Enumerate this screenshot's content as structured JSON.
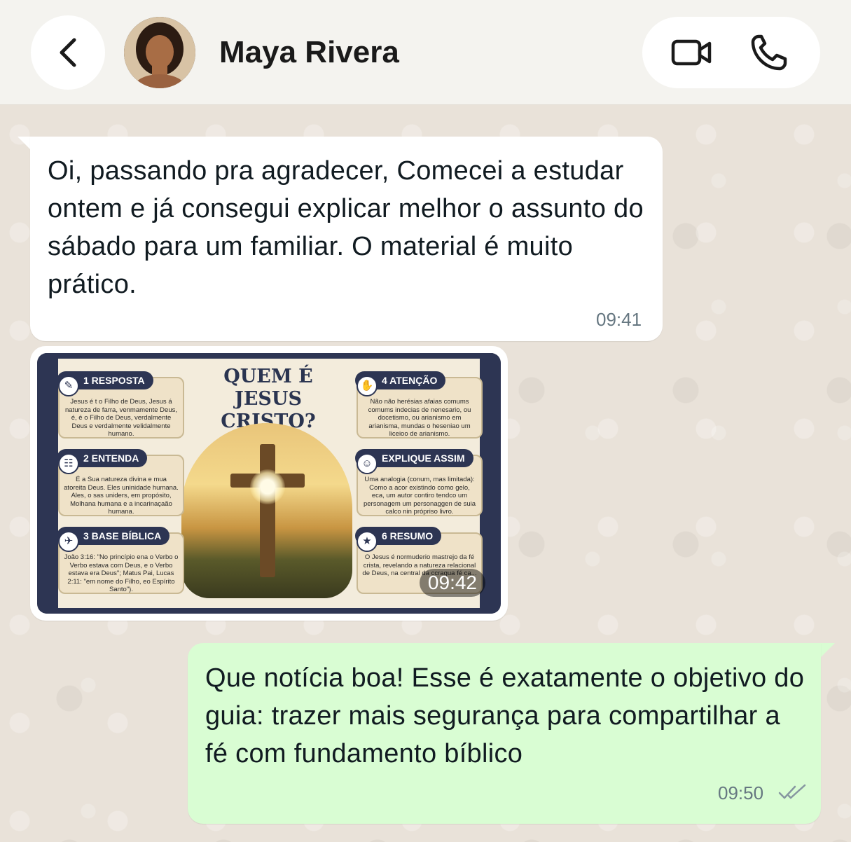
{
  "header": {
    "contact_name": "Maya Rivera",
    "back_icon": "chevron-left-icon",
    "avatar_icon": "contact-avatar",
    "video_call_icon": "video-camera-icon",
    "voice_call_icon": "phone-icon"
  },
  "messages": [
    {
      "direction": "incoming",
      "text": "Oi, passando pra agradecer, Comecei a estudar ontem e já consegui explicar melhor o assunto do sábado para um familiar. O material é muito prático.",
      "time": "09:41"
    },
    {
      "direction": "incoming",
      "type": "image",
      "time": "09:42",
      "image": {
        "title_line1": "QUEM É",
        "title_line2": "JESUS CRISTO?",
        "cards": [
          {
            "label": "1 RESPOSTA",
            "text": "Jesus é t o Filho de Deus, Jesus á natureza de farra, venmamente Deus, é, é o Filho de Deus, verdalmente Deus e verdalmente velidalmente humano."
          },
          {
            "label": "2 ENTENDA",
            "text": "É a Sua natureza divina e mua atoreita Deus. Eles uninidade humana. Ales, o sas uniders, em propósito, Molhana humana e a incarinaçaão humana."
          },
          {
            "label": "3 BASE BÍBLICA",
            "text": "João 3:16: \"No princípio ena o Verbo o Verbo estava com Deus, e o Verbo estava era Deus\"; Matus Pai, Lucas 2:11: \"em nome do Filho, eo Espírito Santo\")."
          },
          {
            "label": "4 ATENÇÃO",
            "text": "Não não herésias afaias comums comums indecias de nenesario, ou docetismo, ou arianismo em arianisma, mundas o heseniao um liceioo de arianismo."
          },
          {
            "label": "EXPLIQUE ASSIM",
            "text": "Uma analogia (conum, mas limitada): Como a acor existindo como gelo, eca, um autor contiro tendco um personagem um personaggen de suia calco nin própriso livro."
          },
          {
            "label": "6 RESUMO",
            "text": "O Jesus é normuderio mastrejo da fé crista, revelando a natureza relacional de Deus, na central da ccragua fé ca..."
          }
        ]
      }
    },
    {
      "direction": "outgoing",
      "text": "Que notícia boa! Esse é exatamente o objetivo do guia: trazer mais segurança para compartilhar a fé com fundamento bíblico",
      "time": "09:50",
      "status_icon": "double-check-icon"
    }
  ],
  "colors": {
    "incoming_bubble": "#ffffff",
    "outgoing_bubble": "#d9fdd3",
    "wallpaper": "#e9e2d9",
    "timestamp": "#667781"
  }
}
